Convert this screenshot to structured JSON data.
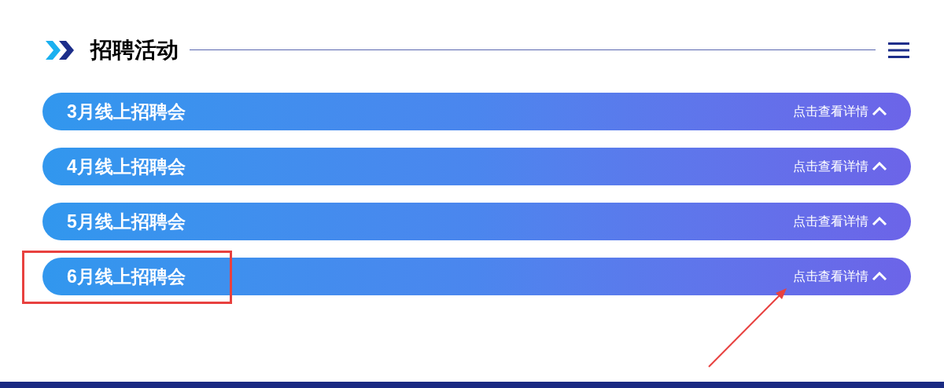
{
  "section": {
    "title": "招聘活动"
  },
  "events": [
    {
      "title": "3月线上招聘会",
      "link": "点击查看详情",
      "highlighted": false,
      "pointed": false
    },
    {
      "title": "4月线上招聘会",
      "link": "点击查看详情",
      "highlighted": false,
      "pointed": false
    },
    {
      "title": "5月线上招聘会",
      "link": "点击查看详情",
      "highlighted": false,
      "pointed": false
    },
    {
      "title": "6月线上招聘会",
      "link": "点击查看详情",
      "highlighted": true,
      "pointed": true
    }
  ]
}
